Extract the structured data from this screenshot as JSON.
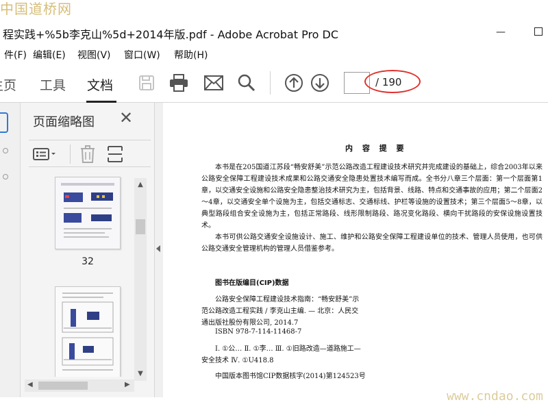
{
  "watermark": {
    "top": "中国道桥网",
    "bottom": "www.cndao.com"
  },
  "window": {
    "title": "程实践+%5b李克山%5d+2014年版.pdf - Adobe Acrobat Pro DC",
    "minimize": "—"
  },
  "menu": [
    "件(F)",
    "编辑(E)",
    "视图(V)",
    "窗口(W)",
    "帮助(H)"
  ],
  "tabs": {
    "home": "主页",
    "tools": "工具",
    "document": "文档"
  },
  "toolbar": {
    "icons": [
      "save-icon",
      "print-icon",
      "email-icon",
      "search-icon",
      "page-up-icon",
      "page-down-icon"
    ],
    "page_current": "",
    "page_total": "/ 190",
    "highlight_color": "#e0302b"
  },
  "panel": {
    "title": "页面缩略图",
    "thumbnails": [
      {
        "label": "32"
      },
      {
        "label": ""
      }
    ]
  },
  "document": {
    "heading": "内 容 提 要",
    "paragraphs": [
      "本书是在205国道江苏段“畅安舒美”示范公路改造工程建设技术研究并完成建设的基础上，综合2003年以来公路安全保障工程建设技术成果和公路交通安全隐患处置技术编写而成。全书分八章三个层面：第一个层面第1章，以交通安全设施和公路安全隐患整治技术研究为主，包括背景、线路、特点和交通事故的应用；第二个层面2～4章，以交通安全单个设施为主，包括交通标志、交通标线、护栏等设施的设置技术；第三个层面5～8章，以典型路段组合安全设施为主，包括正常路段、线形限制路段、路况变化路段、横向干扰路段的安保设施设置技术。",
      "本书可供公路交通安全设施设计、施工、维护和公路安全保障工程建设单位的技术、管理人员使用，也可供公路交通安全管理机构的管理人员借鉴参考。"
    ],
    "cip": {
      "title": "图书在版编目(CIP)数据",
      "lines": [
        "公路安全保障工程建设技术指南：“畅安舒美”示",
        "范公路改造工程实践 / 李克山主编. — 北京：人民交",
        "通出版社股份有限公司, 2014.7",
        "ISBN 978-7-114-11468-7",
        "Ⅰ. ①公…  Ⅱ. ①李…  Ⅲ. ①旧路改造—道路施工—",
        "安全技术  Ⅳ. ①U418.8",
        "中国版本图书馆CIP数据核字(2014)第124523号"
      ]
    }
  }
}
